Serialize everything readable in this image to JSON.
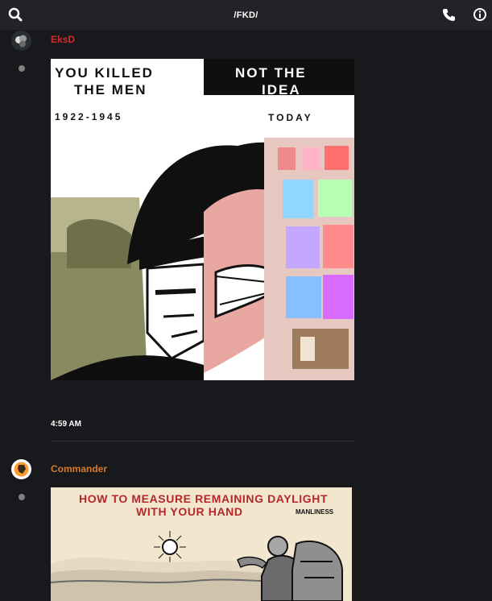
{
  "header": {
    "title": "/FKD/",
    "left_icon": "search-icon",
    "right_icons": [
      "phone-icon",
      "info-icon"
    ]
  },
  "messages": [
    {
      "username": "EksD",
      "username_color": "#d52b2b",
      "avatar_icon": "avatar-icon",
      "image": {
        "top_left": "YOU KILLED",
        "top_left_2": "THE MEN",
        "top_right": "NOT THE",
        "top_right_2": "IDEA",
        "years": "1922-1945",
        "today": "TODAY"
      },
      "time": "4:59 AM"
    },
    {
      "username": "Commander",
      "username_color": "#d57b2b",
      "avatar_icon": "avatar-icon",
      "image": {
        "title_line1": "HOW TO MEASURE REMAINING DAYLIGHT",
        "title_line2": "WITH YOUR HAND",
        "brand": "MANLINESS"
      }
    }
  ]
}
